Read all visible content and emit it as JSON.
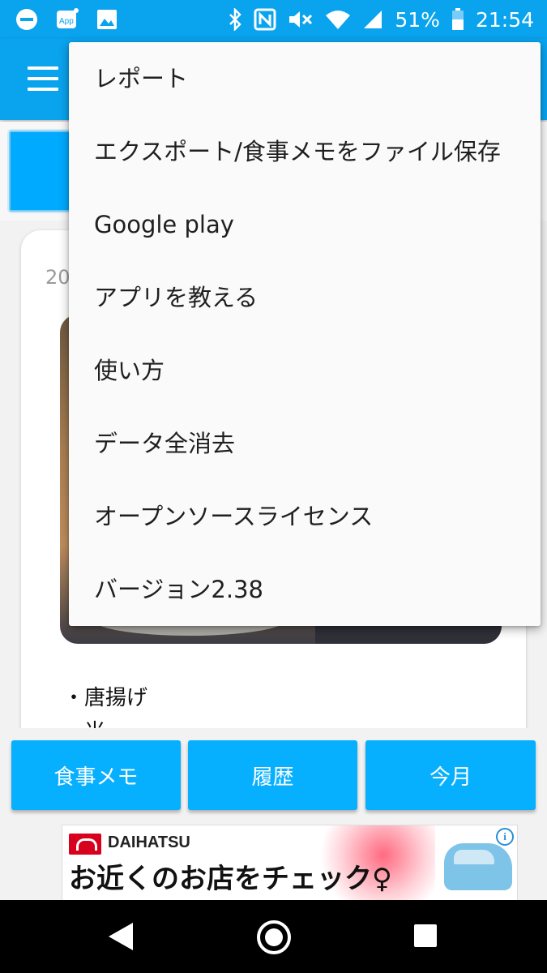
{
  "status_bar": {
    "battery_percent": "51%",
    "time": "21:54"
  },
  "card": {
    "date": "20",
    "food_items": [
      "・唐揚げ",
      "・米"
    ]
  },
  "bottom_buttons": [
    "食事メモ",
    "履歴",
    "今月"
  ],
  "ad": {
    "brand": "DAIHATSU",
    "copy": "お近くのお店をチェック♀"
  },
  "menu": {
    "items": [
      "レポート",
      "エクスポート/食事メモをファイル保存",
      "Google play",
      "アプリを教える",
      "使い方",
      "データ全消去",
      "オープンソースライセンス",
      "バージョン2.38"
    ]
  },
  "colors": {
    "primary": "#0aa3ee",
    "button": "#07b0ff"
  }
}
